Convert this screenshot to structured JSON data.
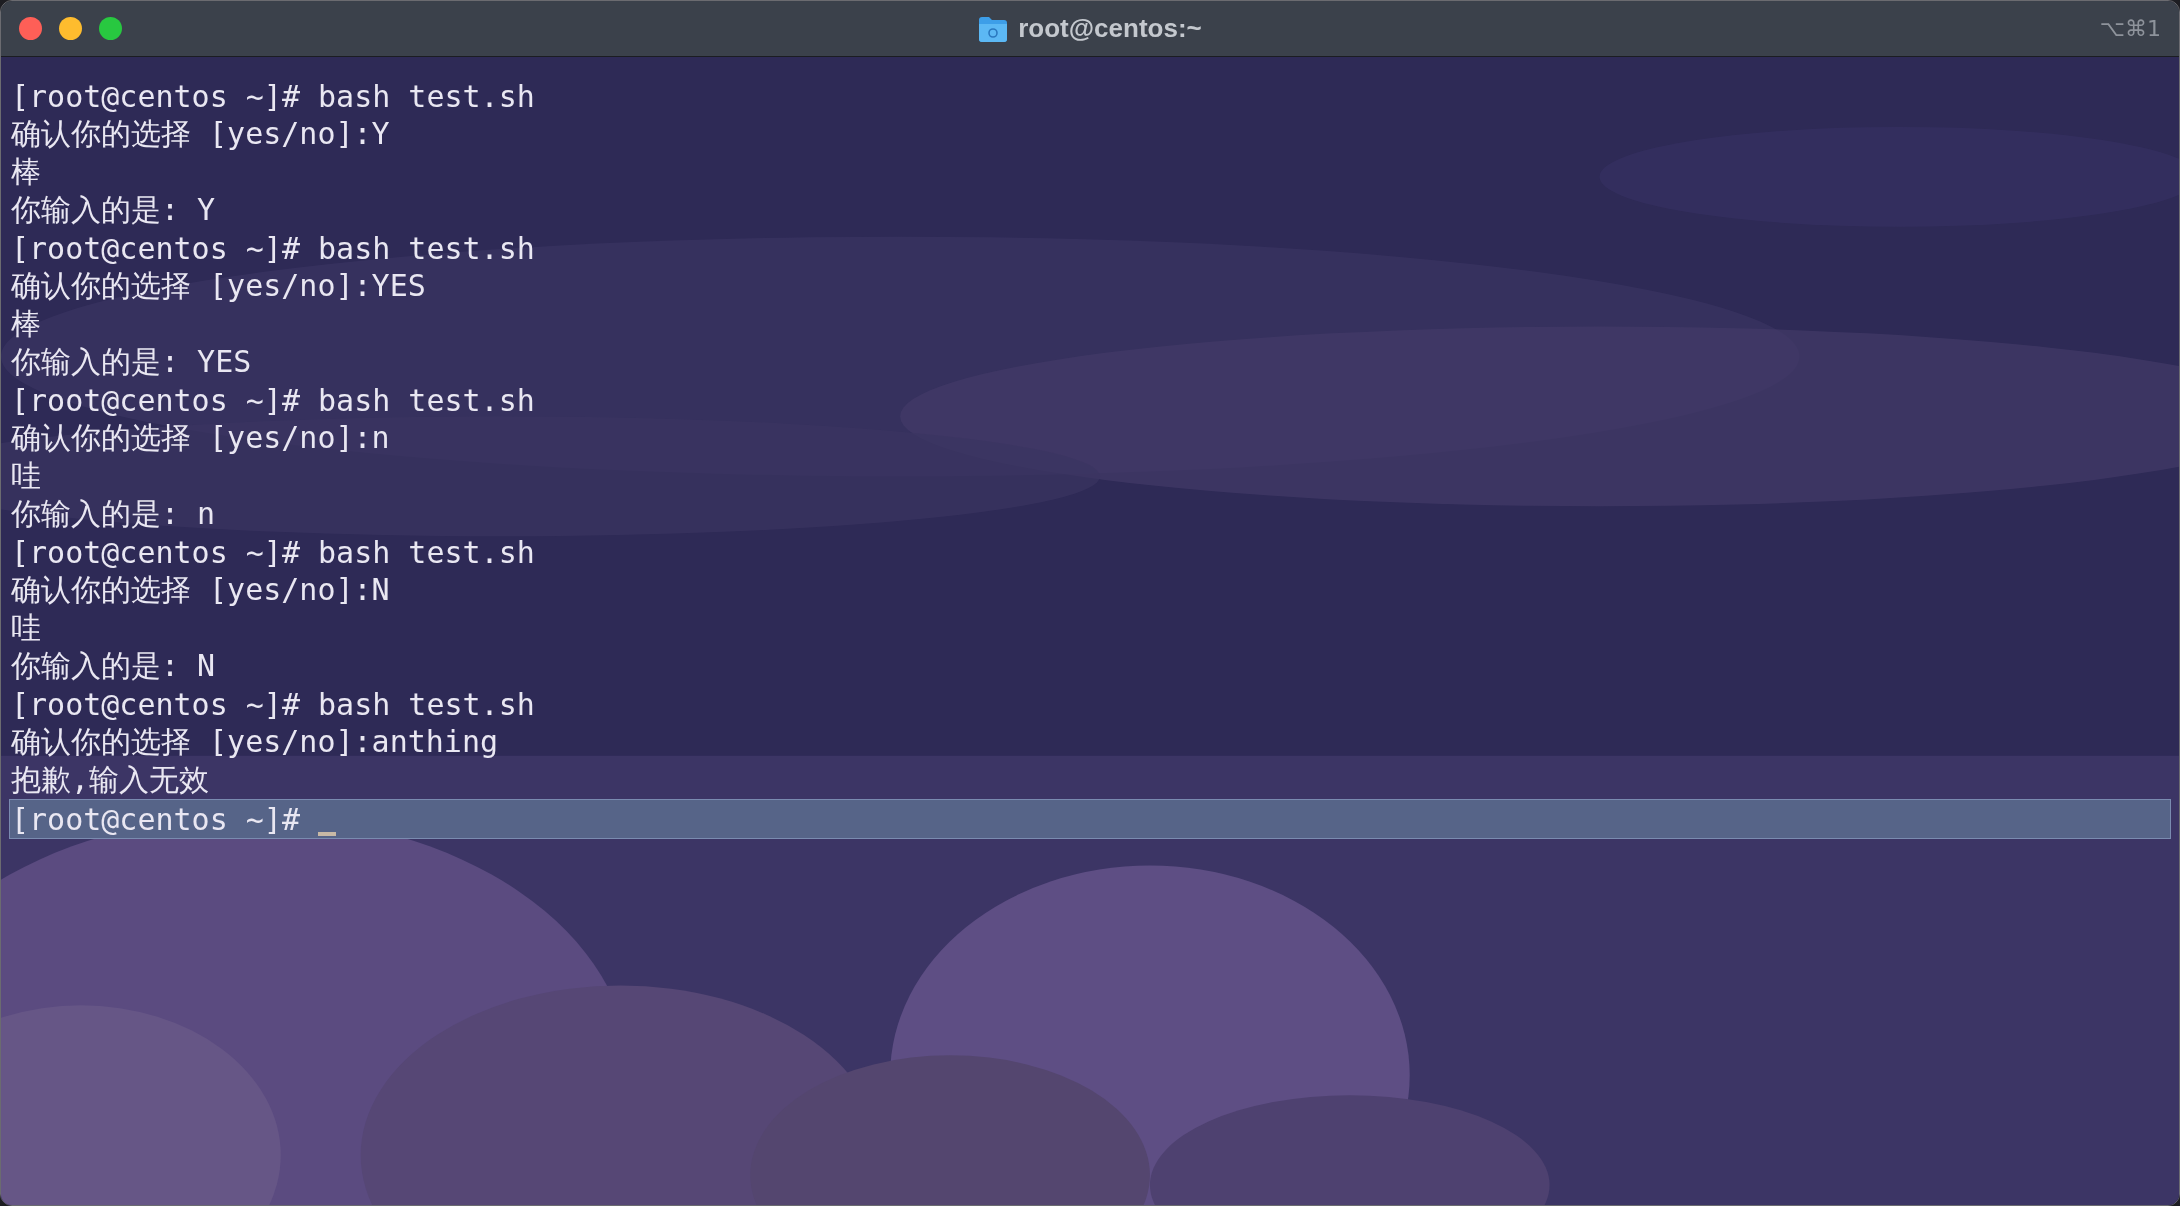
{
  "window": {
    "title": "root@centos:~",
    "shortcut": "⌥⌘1"
  },
  "terminal": {
    "lines": [
      {
        "text": "[root@centos ~]# bash test.sh",
        "highlighted": false
      },
      {
        "text": "确认你的选择 [yes/no]:Y",
        "highlighted": false
      },
      {
        "text": "棒",
        "highlighted": false
      },
      {
        "text": "你输入的是: Y",
        "highlighted": false
      },
      {
        "text": "[root@centos ~]# bash test.sh",
        "highlighted": false
      },
      {
        "text": "确认你的选择 [yes/no]:YES",
        "highlighted": false
      },
      {
        "text": "棒",
        "highlighted": false
      },
      {
        "text": "你输入的是: YES",
        "highlighted": false
      },
      {
        "text": "[root@centos ~]# bash test.sh",
        "highlighted": false
      },
      {
        "text": "确认你的选择 [yes/no]:n",
        "highlighted": false
      },
      {
        "text": "哇",
        "highlighted": false
      },
      {
        "text": "你输入的是: n",
        "highlighted": false
      },
      {
        "text": "[root@centos ~]# bash test.sh",
        "highlighted": false
      },
      {
        "text": "确认你的选择 [yes/no]:N",
        "highlighted": false
      },
      {
        "text": "哇",
        "highlighted": false
      },
      {
        "text": "你输入的是: N",
        "highlighted": false
      },
      {
        "text": "[root@centos ~]# bash test.sh",
        "highlighted": false
      },
      {
        "text": "确认你的选择 [yes/no]:anthing",
        "highlighted": false
      },
      {
        "text": "抱歉,输入无效",
        "highlighted": false
      },
      {
        "text": "[root@centos ~]#",
        "highlighted": true,
        "cursor": true
      }
    ]
  }
}
